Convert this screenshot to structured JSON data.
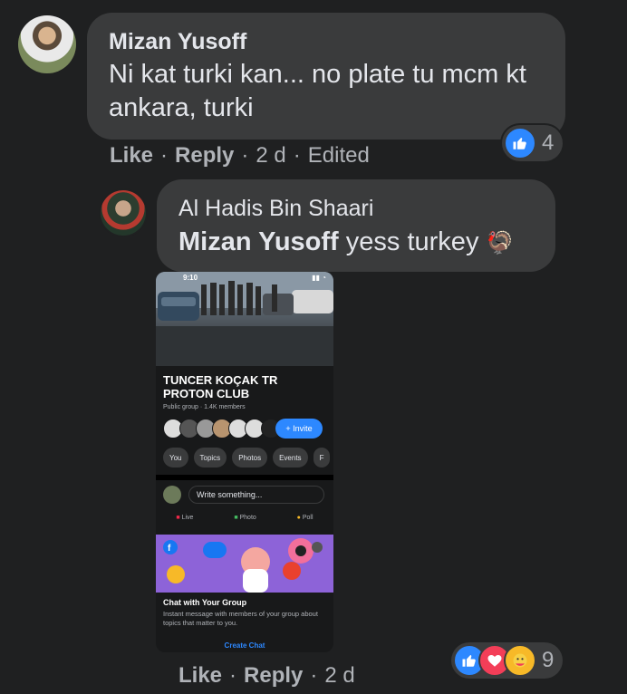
{
  "comment": {
    "author": "Mizan Yusoff",
    "text": "Ni kat turki kan... no plate tu mcm kt ankara, turki",
    "like_label": "Like",
    "reply_label": "Reply",
    "time": "2 d",
    "edited": "Edited",
    "reaction_count": "4"
  },
  "reply": {
    "author": "Al Hadis Bin Shaari",
    "mention": "Mizan Yusoff",
    "text": "yess turkey",
    "emoji": "🦃",
    "like_label": "Like",
    "reply_label": "Reply",
    "time": "2 d",
    "reaction_count": "9",
    "attachment": {
      "status_time": "9:10",
      "group_name": "TUNCER KOÇAK TR PROTON CLUB",
      "group_meta": "Public group · 1.4K members",
      "invite_label": "+ Invite",
      "chips": [
        "You",
        "Topics",
        "Photos",
        "Events",
        "F"
      ],
      "write_placeholder": "Write something...",
      "actions": [
        "Live",
        "Photo",
        "Poll"
      ],
      "chat_title": "Chat with Your Group",
      "chat_desc": "Instant message with members of your group about topics that matter to you.",
      "create_chat": "Create Chat"
    }
  },
  "colors": {
    "background": "#1f2021",
    "bubble": "#3a3b3c",
    "like_blue": "#2d88ff",
    "love_red": "#f33e58"
  }
}
